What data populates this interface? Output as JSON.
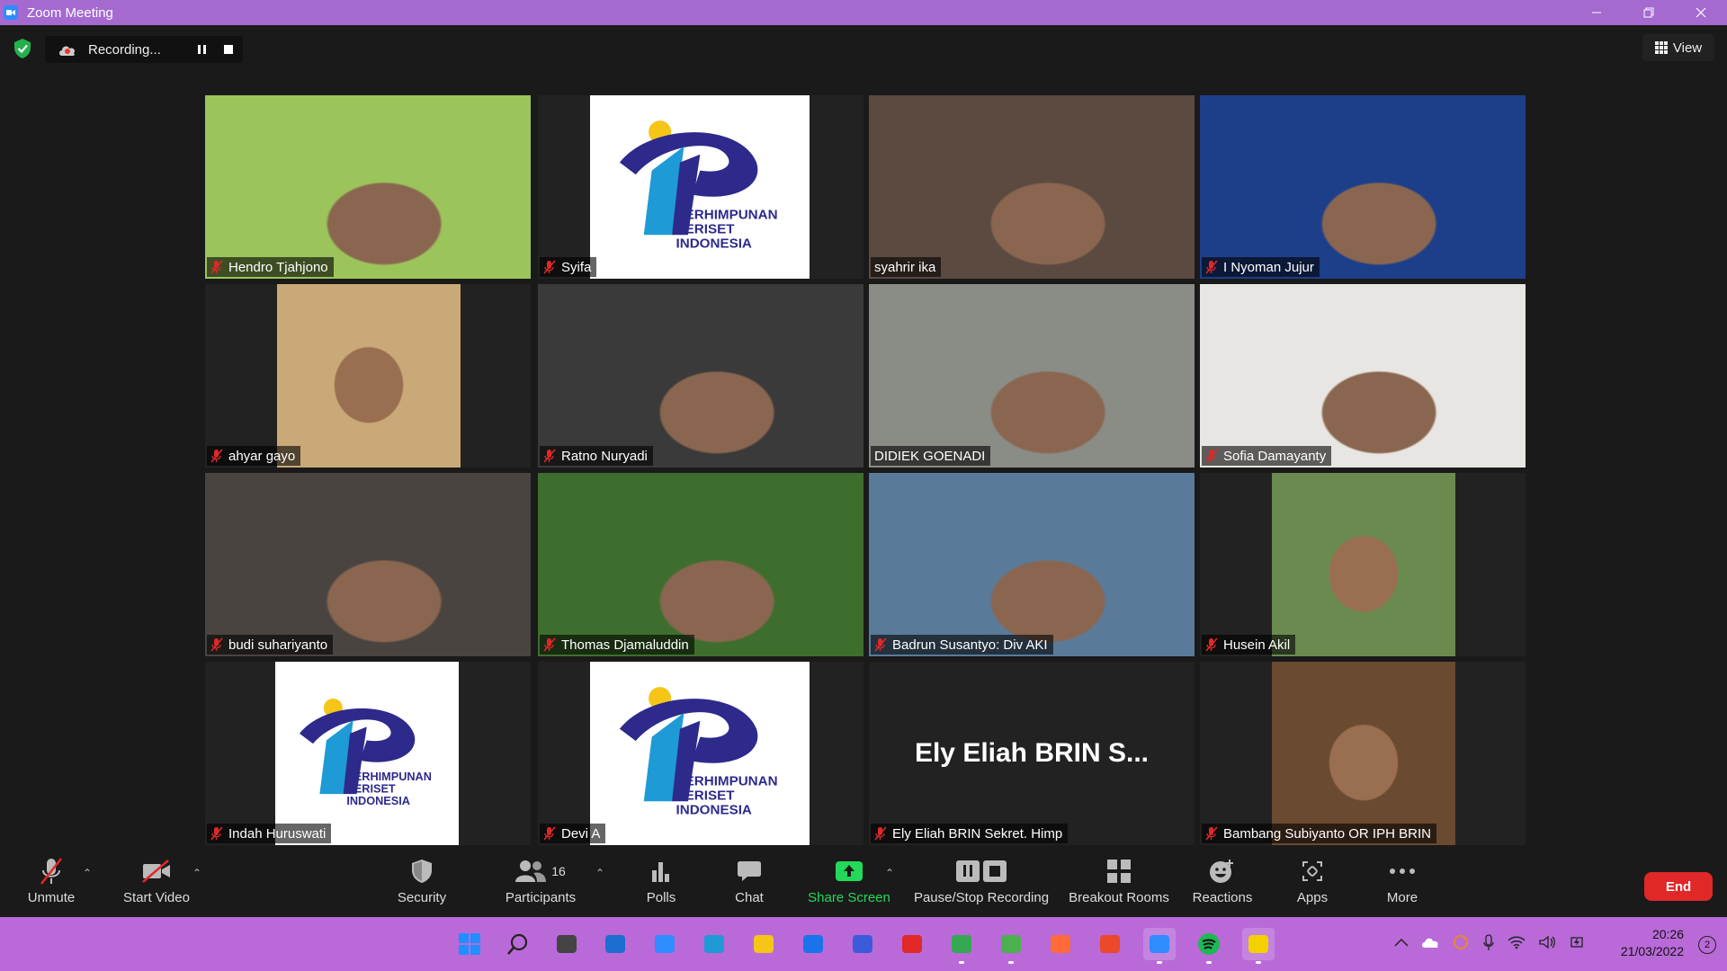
{
  "window": {
    "title": "Zoom Meeting",
    "minimize_icon": "minimize-icon",
    "restore_icon": "restore-icon",
    "close_icon": "close-icon"
  },
  "topbar": {
    "recording_label": "Recording...",
    "view_label": "View",
    "security_status": "encrypted"
  },
  "participants": [
    {
      "name": "Hendro Tjahjono",
      "muted": true,
      "video": "video",
      "bg": "#9bc45a"
    },
    {
      "name": "Syifa",
      "muted": true,
      "video": "logo"
    },
    {
      "name": "syahrir ika",
      "muted": false,
      "video": "video",
      "bg": "#5a4a40",
      "active_speaker": true
    },
    {
      "name": "I Nyoman Jujur",
      "muted": true,
      "video": "video",
      "bg": "#1d3f8a"
    },
    {
      "name": "ahyar gayo",
      "muted": true,
      "video": "video-narrow",
      "bg": "#c9a978"
    },
    {
      "name": "Ratno Nuryadi",
      "muted": true,
      "video": "video",
      "bg": "#3a3a3a"
    },
    {
      "name": "DIDIEK GOENADI",
      "muted": false,
      "video": "video",
      "bg": "#8a8c86"
    },
    {
      "name": "Sofia Damayanty",
      "muted": true,
      "video": "video",
      "bg": "#e8e6e2"
    },
    {
      "name": "budi suhariyanto",
      "muted": true,
      "video": "video",
      "bg": "#4a4440"
    },
    {
      "name": "Thomas Djamaluddin",
      "muted": true,
      "video": "video",
      "bg": "#3e6e2e"
    },
    {
      "name": "Badrun Susantyo: Div AKI",
      "muted": true,
      "video": "video",
      "bg": "#5a7a9a"
    },
    {
      "name": "Husein Akil",
      "muted": true,
      "video": "video-narrow",
      "bg": "#6a8a50"
    },
    {
      "name": "Indah Huruswati",
      "muted": true,
      "video": "logo-narrow"
    },
    {
      "name": "Devi A",
      "muted": true,
      "video": "logo"
    },
    {
      "name": "Ely Eliah BRIN Sekret. Himp",
      "muted": true,
      "video": "none",
      "display_name": "Ely Eliah BRIN S..."
    },
    {
      "name": "Bambang Subiyanto OR IPH BRIN",
      "muted": true,
      "video": "video-narrow",
      "bg": "#6a4a30"
    }
  ],
  "logo_text": {
    "line1": "PERHIMPUNAN",
    "line2": "PERISET",
    "line3": "INDONESIA"
  },
  "toolbar": {
    "unmute": "Unmute",
    "start_video": "Start Video",
    "security": "Security",
    "participants": "Participants",
    "participants_count": "16",
    "polls": "Polls",
    "chat": "Chat",
    "share_screen": "Share Screen",
    "pause_stop_recording": "Pause/Stop Recording",
    "breakout_rooms": "Breakout Rooms",
    "reactions": "Reactions",
    "apps": "Apps",
    "more": "More",
    "end": "End"
  },
  "taskbar": {
    "time": "20:26",
    "date": "21/03/2022",
    "notifications": "2",
    "apps": [
      "windows-start-icon",
      "search-icon",
      "task-view-icon",
      "widgets-icon",
      "zoom-app-icon",
      "edge-icon",
      "file-explorer-icon",
      "mail-icon",
      "app-icon",
      "acrobat-icon",
      "chrome-icon",
      "chrome-alt-icon",
      "photos-icon",
      "office-icon",
      "zoom-icon",
      "spotify-icon",
      "sticky-notes-icon"
    ]
  },
  "colors": {
    "title_bar": "#a46ad0",
    "taskbar": "#b96ad8",
    "active_speaker": "#e8e860",
    "share_green": "#23d959",
    "end_red": "#e02828"
  }
}
